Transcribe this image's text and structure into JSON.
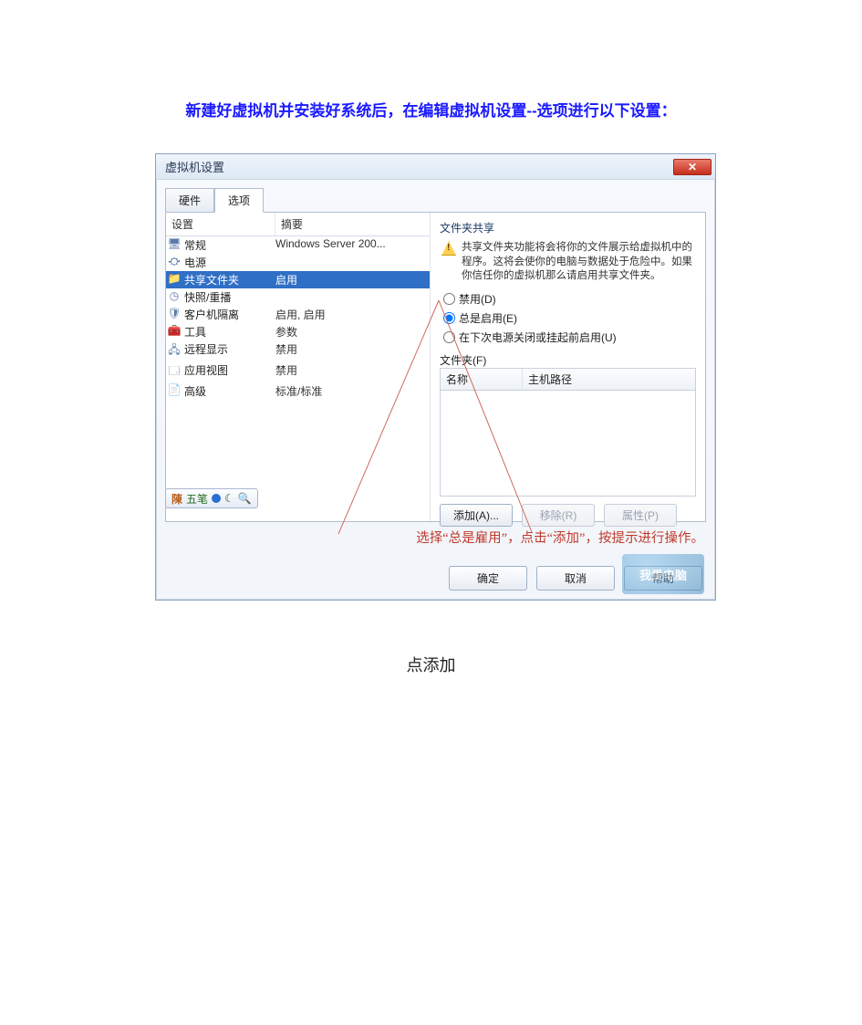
{
  "heading": "新建好虚拟机并安装好系统后，在编辑虚拟机设置--选项进行以下设置：",
  "dialog": {
    "title": "虚拟机设置",
    "close_x": "✕",
    "tabs": {
      "hardware": "硬件",
      "options": "选项"
    },
    "columns": {
      "setting": "设置",
      "summary": "摘要"
    },
    "rows": [
      {
        "icon": "🖥",
        "name": "常规",
        "summary": "Windows Server 200..."
      },
      {
        "icon": "⛮",
        "name": "电源",
        "summary": ""
      },
      {
        "icon": "📁",
        "name": "共享文件夹",
        "summary": "启用",
        "selected": true
      },
      {
        "icon": "◷",
        "name": "快照/重播",
        "summary": ""
      },
      {
        "icon": "🛡",
        "name": "客户机隔离",
        "summary": "启用, 启用"
      },
      {
        "icon": "🧰",
        "name": "工具",
        "summary": "参数"
      },
      {
        "icon": "🖧",
        "name": "远程显示",
        "summary": "禁用"
      },
      {
        "icon": "🗔",
        "name": "应用视图",
        "summary": "禁用"
      },
      {
        "icon": "📄",
        "name": "高级",
        "summary": "标准/标准"
      }
    ],
    "ime": {
      "chen": "陳",
      "wubi": "五笔"
    },
    "right": {
      "group_title": "文件夹共享",
      "warning": "共享文件夹功能将会将你的文件展示给虚拟机中的程序。这将会使你的电脑与数据处于危险中。如果你信任你的虚拟机那么请启用共享文件夹。",
      "radio_disable": "禁用(D)",
      "radio_always": "总是启用(E)",
      "radio_next": "在下次电源关闭或挂起前启用(U)",
      "folders_label": "文件夹(F)",
      "folders_cols": {
        "name": "名称",
        "path": "主机路径"
      },
      "btn_add": "添加(A)...",
      "btn_remove": "移除(R)",
      "btn_props": "属性(P)"
    },
    "annotation": "选择“总是雇用”，点击“添加”，按提示进行操作。",
    "watermark": "我爱电脑",
    "footer": {
      "ok": "确定",
      "cancel": "取消",
      "help": "帮助"
    }
  },
  "caption": "点添加"
}
